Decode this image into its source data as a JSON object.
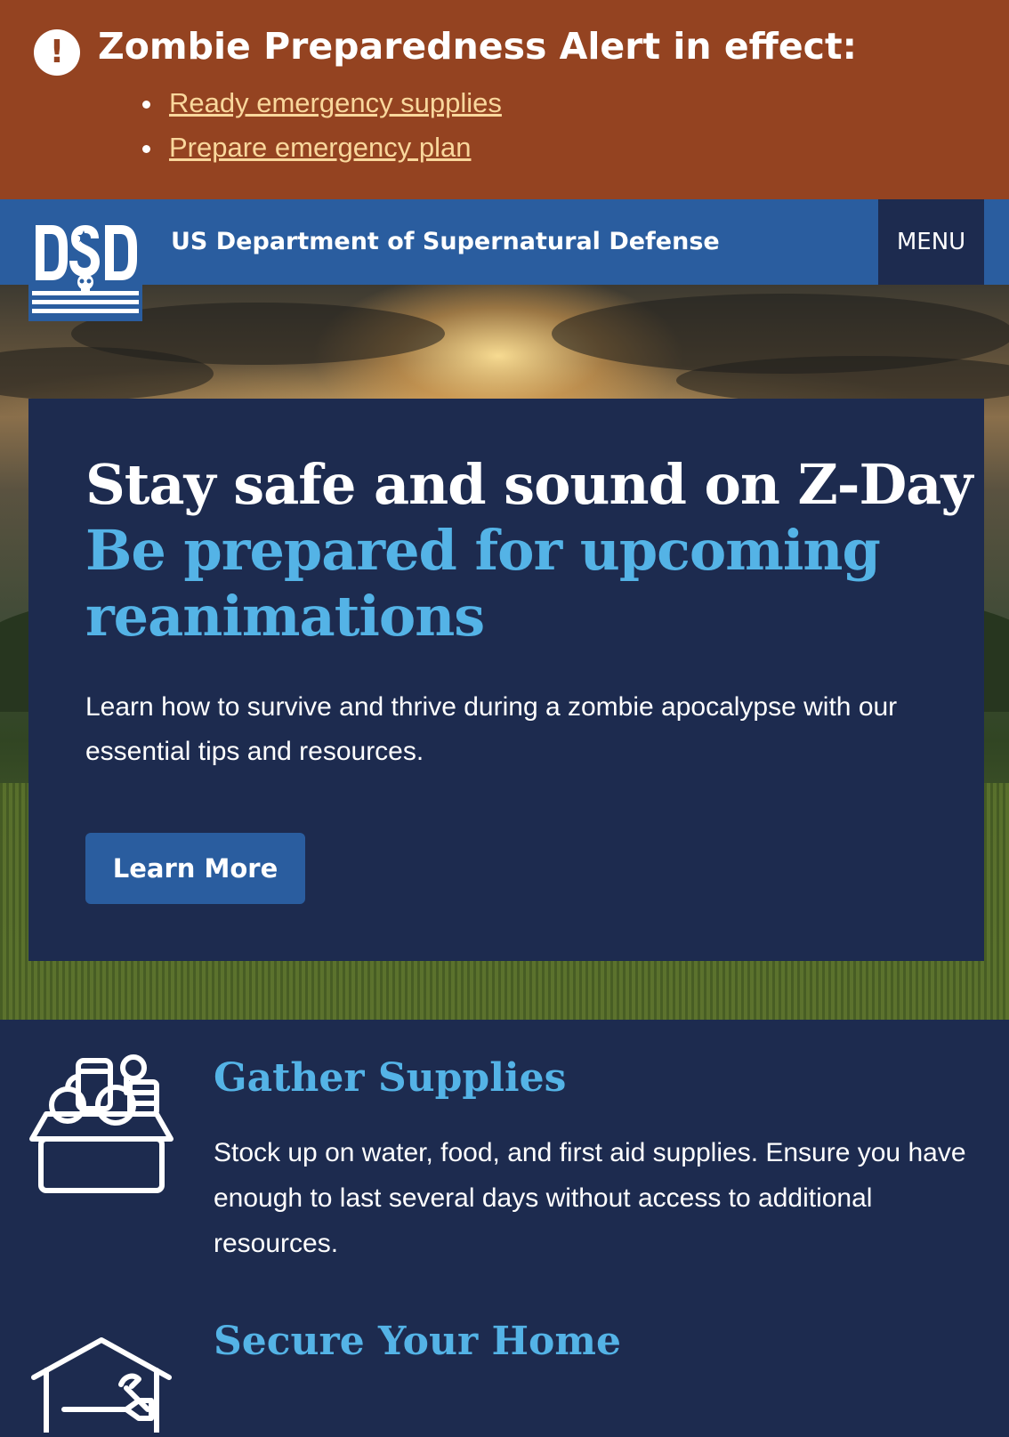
{
  "alert": {
    "icon": "exclamation-icon",
    "title": "Zombie Preparedness Alert in effect:",
    "links": [
      {
        "label": "Ready emergency supplies"
      },
      {
        "label": "Prepare emergency plan"
      }
    ]
  },
  "header": {
    "logo_text": "DSD",
    "site_name": "US Department of Supernatural Defense",
    "menu_label": "MENU"
  },
  "hero": {
    "title": "Stay safe and sound on Z-Day",
    "subtitle": "Be prepared for upcoming reanimations",
    "body": "Learn how to survive and thrive during a zombie apocalypse with our essential tips and resources.",
    "button_label": "Learn More"
  },
  "features": [
    {
      "icon": "supplies-box-icon",
      "title": "Gather Supplies",
      "text": "Stock up on water, food, and first aid supplies. Ensure you have enough to last several days without access to additional resources."
    },
    {
      "icon": "home-tools-icon",
      "title": "Secure Your Home",
      "text": ""
    }
  ],
  "colors": {
    "alert_bg": "#944321",
    "header_bg": "#2a5d9f",
    "navy": "#1d2b4f",
    "accent_blue": "#54b3e6",
    "link_gold": "#f9d79c"
  }
}
